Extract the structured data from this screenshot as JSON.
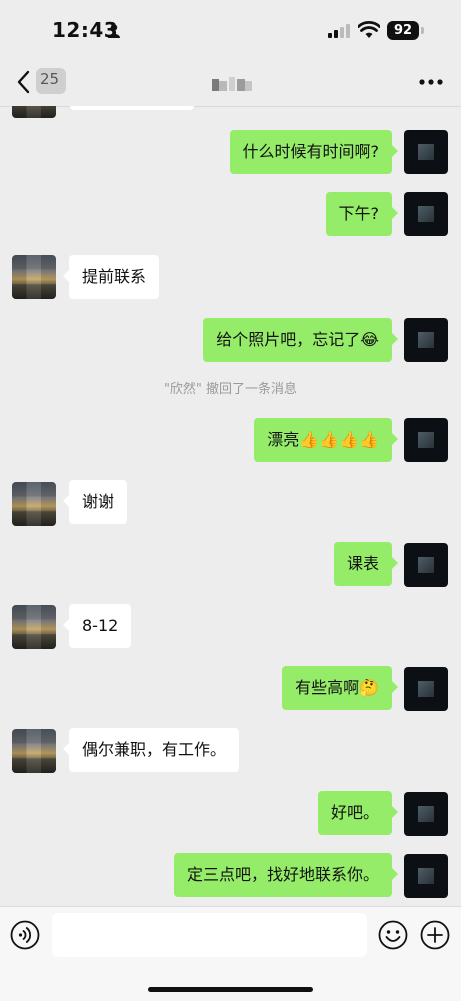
{
  "status_bar": {
    "time": "12:43",
    "battery": "92"
  },
  "nav": {
    "unread_count": "25",
    "title": ""
  },
  "messages": [
    {
      "side": "out",
      "text": "什么时候有时间啊?"
    },
    {
      "side": "out",
      "text": "下午?"
    },
    {
      "side": "in",
      "text": "提前联系"
    },
    {
      "side": "out",
      "text": "给个照片吧，忘记了😂"
    },
    {
      "side": "system",
      "text": "\"欣然\" 撤回了一条消息"
    },
    {
      "side": "out",
      "text": "漂亮👍👍👍👍"
    },
    {
      "side": "in",
      "text": "谢谢"
    },
    {
      "side": "out",
      "text": "课表"
    },
    {
      "side": "in",
      "text": "8-12"
    },
    {
      "side": "out",
      "text": "有些高啊🤔"
    },
    {
      "side": "in",
      "text": "偶尔兼职，有工作。"
    },
    {
      "side": "out",
      "text": "好吧。"
    },
    {
      "side": "out",
      "text": "定三点吧，找好地联系你。"
    }
  ],
  "input": {
    "placeholder": ""
  },
  "icons": {
    "back": "chevron-left-icon",
    "more": "more-dots-icon",
    "voice": "voice-icon",
    "emoji": "emoji-icon",
    "plus": "plus-icon",
    "person": "person-icon",
    "signal": "signal-icon",
    "wifi": "wifi-icon"
  },
  "colors": {
    "background": "#ededed",
    "outgoing_bubble": "#95ec69",
    "incoming_bubble": "#ffffff",
    "system_text": "#9a9a9a"
  }
}
